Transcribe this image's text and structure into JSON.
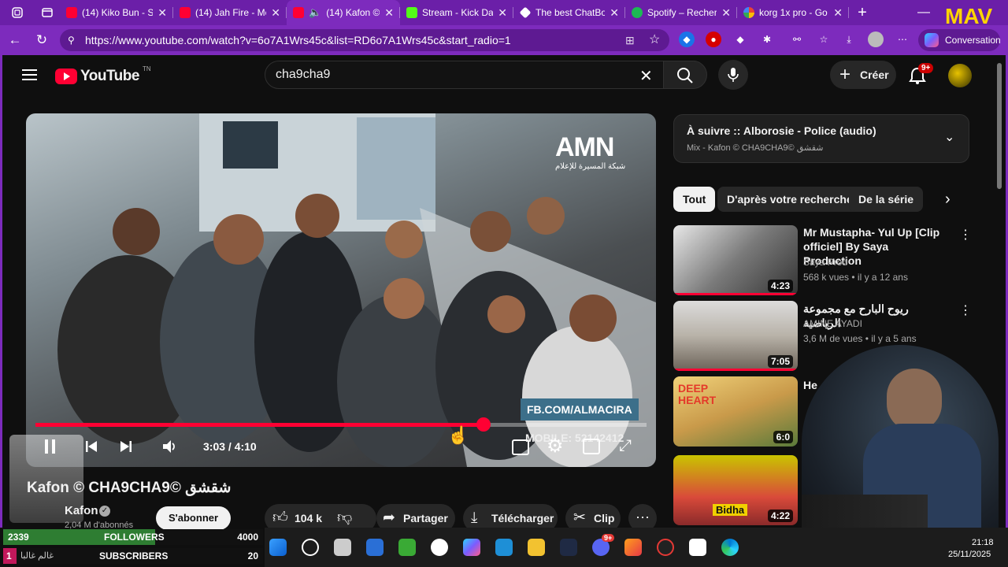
{
  "browser": {
    "tabs": [
      {
        "title": "(14) Kiko Bun - Sl",
        "favicon": "youtube"
      },
      {
        "title": "(14) Jah Fire - Mc",
        "favicon": "youtube"
      },
      {
        "title": "(14) Kafon ©",
        "favicon": "youtube",
        "active": true
      },
      {
        "title": "Stream - Kick Da",
        "favicon": "kick"
      },
      {
        "title": "The best ChatBot",
        "favicon": "chatbot"
      },
      {
        "title": "Spotify – Recherc",
        "favicon": "spotify"
      },
      {
        "title": "korg 1x pro - Go",
        "favicon": "google"
      }
    ],
    "url": "https://www.youtube.com/watch?v=6o7A1Wrs45c&list=RD6o7A1Wrs45c&start_radio=1",
    "conversation_label": "Conversation"
  },
  "youtube": {
    "logo_text": "YouTube",
    "logo_suffix": "TN",
    "search_value": "cha9cha9",
    "create_label": "Créer",
    "notification_count": "9+"
  },
  "player": {
    "time": "3:03 / 4:10",
    "progress": 0.733,
    "watermark_top": "AMN",
    "watermark_sub": "شبكة المسيرة للإعلام",
    "watermark_fb": "FB.COM/ALMACIRA",
    "watermark_mobile": "MOBILE: 52142412"
  },
  "video": {
    "title": "Kafon © CHA9CHA9© شقشق",
    "channel": "Kafon",
    "subscribers": "2,04 M d'abonnés",
    "subscribe_label": "S'abonner",
    "likes": "104 k",
    "share_label": "Partager",
    "download_label": "Télécharger",
    "clip_label": "Clip"
  },
  "up_next": {
    "title": "À suivre :: Alborosie - Police (audio)",
    "subtitle": "Mix - Kafon © CHA9CHA9© شقشق"
  },
  "chips": [
    "Tout",
    "D'après votre recherche",
    "De la série"
  ],
  "recommendations": [
    {
      "title": "Mr Mustapha- Yul Up [Clip officiel] By Saya Production",
      "channel": "Saya Prod",
      "meta": "568 k vues • il y a 12 ans",
      "duration": "4:23"
    },
    {
      "title": "ريوح البارح مع مجموعة الرياضية",
      "channel": "AMINE AYADI",
      "meta": "3,6 M de vues • il y a 5 ans",
      "duration": "7:05"
    },
    {
      "title": "He",
      "channel": "",
      "meta": "",
      "duration": "6:0",
      "thumb_text": "DEEP HEART"
    },
    {
      "title": "",
      "channel": "",
      "meta": "",
      "duration": "4:22",
      "thumb_text": "Bidha"
    }
  ],
  "stream_overlay": {
    "followers_label": "FOLLOWERS",
    "followers_count": "2339",
    "followers_goal": "4000",
    "followers_progress": 0.585,
    "subscribers_label": "SUBSCRIBERS",
    "subscribers_count": "1",
    "subscribers_goal": "20",
    "subscribers_progress": 0.05,
    "subscriber_name": "غالم غالبا"
  },
  "taskbar": {
    "time": "21:18",
    "date": "25/11/2025",
    "discord_badge": "9+"
  },
  "colors": {
    "browser_accent": "#7d2bbd",
    "youtube_red": "#ff0033",
    "youtube_bg": "#0f0f0f",
    "overlay_green": "#2e7d32"
  }
}
